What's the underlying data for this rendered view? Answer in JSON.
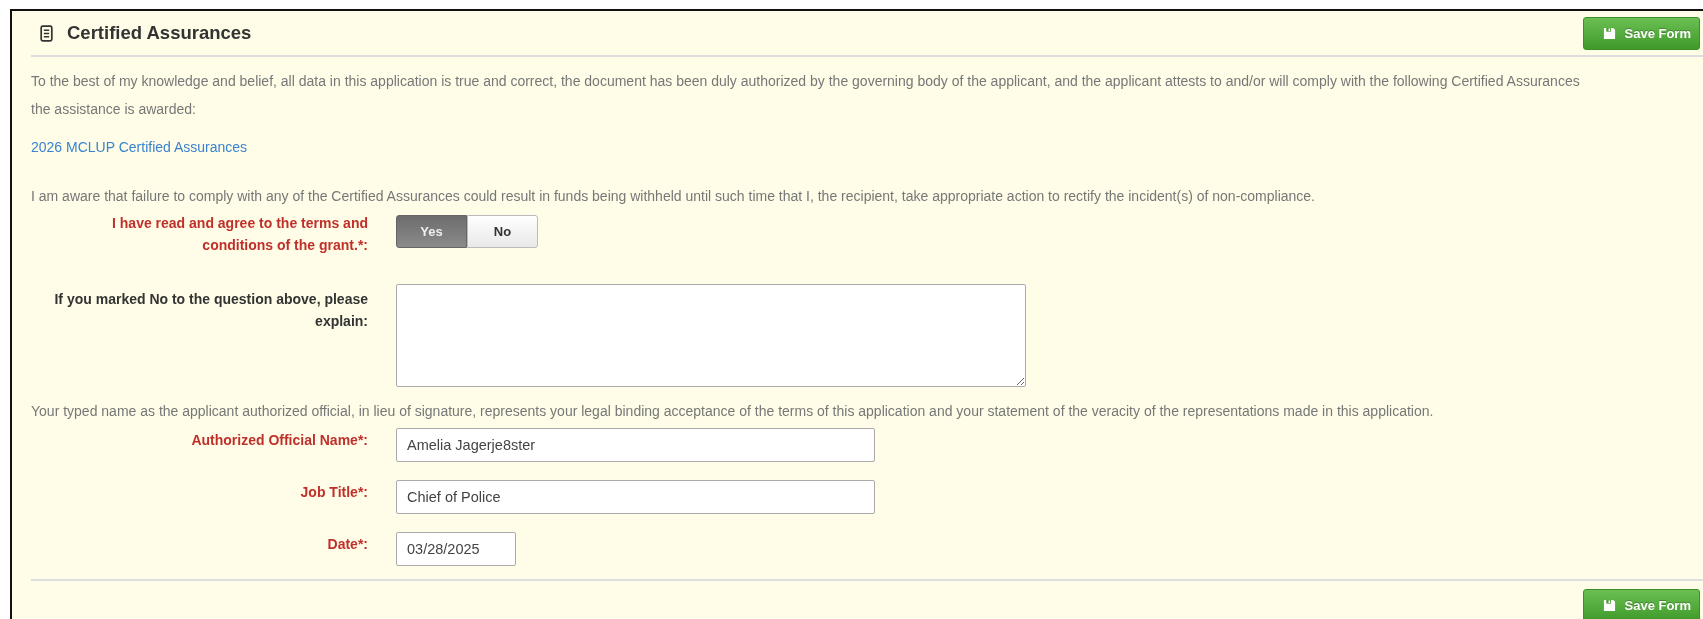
{
  "header": {
    "title": "Certified Assurances",
    "save_button": "Save Form"
  },
  "intro_lines": [
    "To the best of my knowledge and belief, all data in this application is true and correct, the document has been duly authorized by the governing body of the applicant, and the applicant attests to and/or will comply with the following Certified Assurances",
    "the assistance is awarded:"
  ],
  "link": "2026 MCLUP Certified Assurances",
  "awareness_text": "I am aware that failure to comply with any of the Certified Assurances could result in funds being withheld until such time that I, the recipient, take appropriate action to rectify the incident(s) of non-compliance.",
  "agreement": {
    "label": "I have read and agree to the terms and conditions of the grant.*:",
    "required": true,
    "options": [
      {
        "label": "Yes",
        "selected": true
      },
      {
        "label": "No",
        "selected": false
      }
    ]
  },
  "explanation": {
    "label": "If you marked No to the question above, please explain:",
    "required": false
  },
  "signature_text": "Your typed name as the applicant authorized official, in lieu of signature, represents your legal binding acceptance of the terms of this application and your statement of the veracity of the representations made in this application.",
  "fields": [
    {
      "label": "Authorized Official Name*:",
      "value": "Amelia Jagerje8ster",
      "required": true,
      "kind": "wide"
    },
    {
      "label": "Job Title*:",
      "value": "Chief of Police",
      "required": true,
      "kind": "wide"
    },
    {
      "label": "Date*:",
      "value": "03/28/2025",
      "required": true,
      "kind": "date"
    }
  ],
  "footer": {
    "save_button": "Save Form"
  }
}
